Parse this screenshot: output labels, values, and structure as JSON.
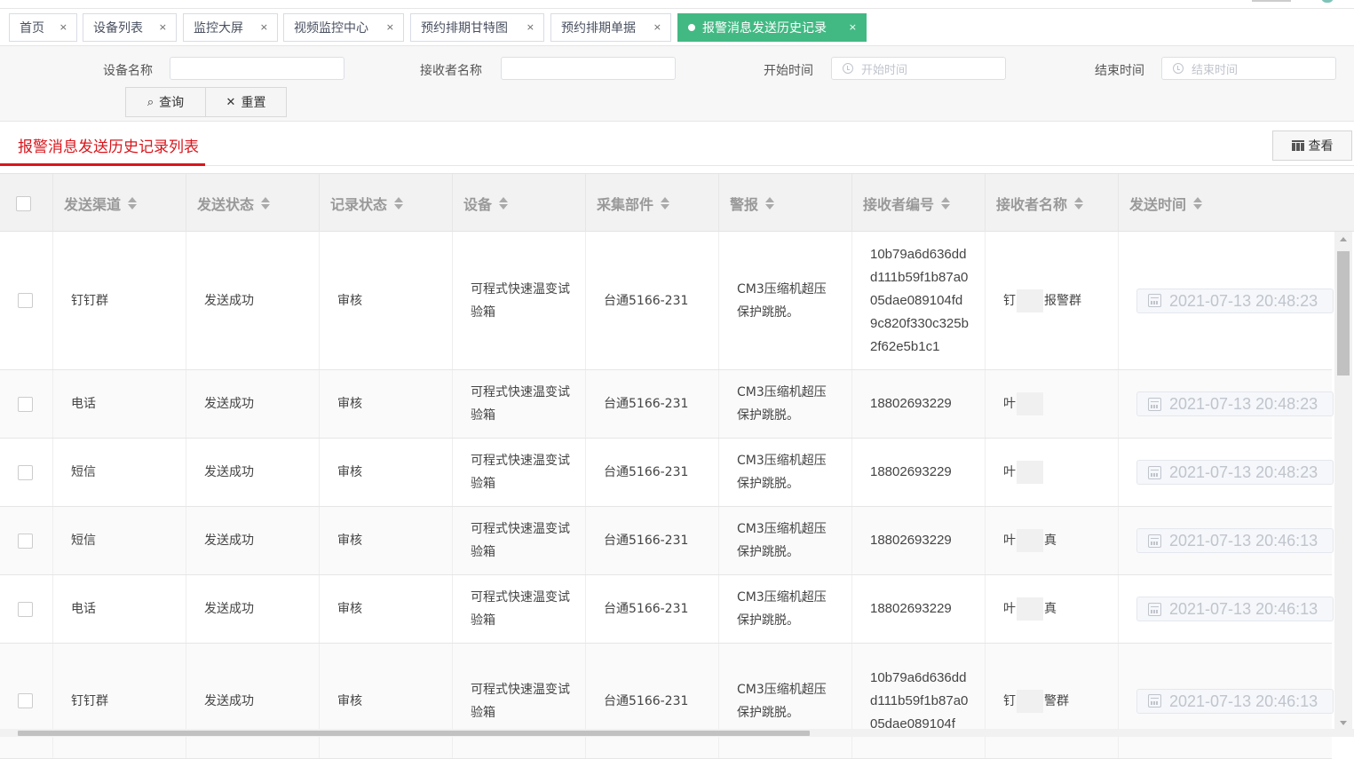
{
  "tabs": [
    {
      "label": "首页",
      "close": "×"
    },
    {
      "label": "设备列表",
      "close": "×"
    },
    {
      "label": "监控大屏",
      "close": "×"
    },
    {
      "label": "视频监控中心",
      "close": "×"
    },
    {
      "label": "预约排期甘特图",
      "close": "×"
    },
    {
      "label": "预约排期单据",
      "close": "×"
    },
    {
      "label": "报警消息发送历史记录",
      "close": "×"
    }
  ],
  "filter": {
    "device_name_label": "设备名称",
    "receiver_name_label": "接收者名称",
    "start_time_label": "开始时间",
    "start_time_placeholder": "开始时间",
    "end_time_label": "结束时间",
    "end_time_placeholder": "结束时间",
    "query_label": "查询",
    "reset_label": "重置"
  },
  "list": {
    "title": "报警消息发送历史记录列表",
    "view_label": "查看"
  },
  "columns": [
    "发送渠道",
    "发送状态",
    "记录状态",
    "设备",
    "采集部件",
    "警报",
    "接收者编号",
    "接收者名称",
    "发送时间"
  ],
  "rows": [
    {
      "channel": "钉钉群",
      "send_status": "发送成功",
      "record_status": "审核",
      "device": "可程式快速温变试验箱",
      "part": "台通5166-231",
      "alarm": "CM3压缩机超压保护跳脱。",
      "receiver_id": "10b79a6d636ddd111b59f1b87a005dae089104fd9c820f330c325b2f62e5b1c1",
      "receiver_name_a": "钉",
      "receiver_name_b": "报警群",
      "time": "2021-07-13 20:48:23"
    },
    {
      "channel": "电话",
      "send_status": "发送成功",
      "record_status": "审核",
      "device": "可程式快速温变试验箱",
      "part": "台通5166-231",
      "alarm": "CM3压缩机超压保护跳脱。",
      "receiver_id": "18802693229",
      "receiver_name_a": "叶",
      "receiver_name_b": "",
      "time": "2021-07-13 20:48:23"
    },
    {
      "channel": "短信",
      "send_status": "发送成功",
      "record_status": "审核",
      "device": "可程式快速温变试验箱",
      "part": "台通5166-231",
      "alarm": "CM3压缩机超压保护跳脱。",
      "receiver_id": "18802693229",
      "receiver_name_a": "叶",
      "receiver_name_b": "",
      "time": "2021-07-13 20:48:23"
    },
    {
      "channel": "短信",
      "send_status": "发送成功",
      "record_status": "审核",
      "device": "可程式快速温变试验箱",
      "part": "台通5166-231",
      "alarm": "CM3压缩机超压保护跳脱。",
      "receiver_id": "18802693229",
      "receiver_name_a": "叶",
      "receiver_name_b": "真",
      "time": "2021-07-13 20:46:13"
    },
    {
      "channel": "电话",
      "send_status": "发送成功",
      "record_status": "审核",
      "device": "可程式快速温变试验箱",
      "part": "台通5166-231",
      "alarm": "CM3压缩机超压保护跳脱。",
      "receiver_id": "18802693229",
      "receiver_name_a": "叶",
      "receiver_name_b": "真",
      "time": "2021-07-13 20:46:13"
    },
    {
      "channel": "钉钉群",
      "send_status": "发送成功",
      "record_status": "审核",
      "device": "可程式快速温变试验箱",
      "part": "台通5166-231",
      "alarm": "CM3压缩机超压保护跳脱。",
      "receiver_id": "10b79a6d636ddd111b59f1b87a005dae089104f",
      "receiver_name_a": "钉",
      "receiver_name_b": "警群",
      "time": "2021-07-13 20:46:13"
    }
  ],
  "colors": {
    "accent_green": "#42b983",
    "title_red": "#d9161c"
  }
}
